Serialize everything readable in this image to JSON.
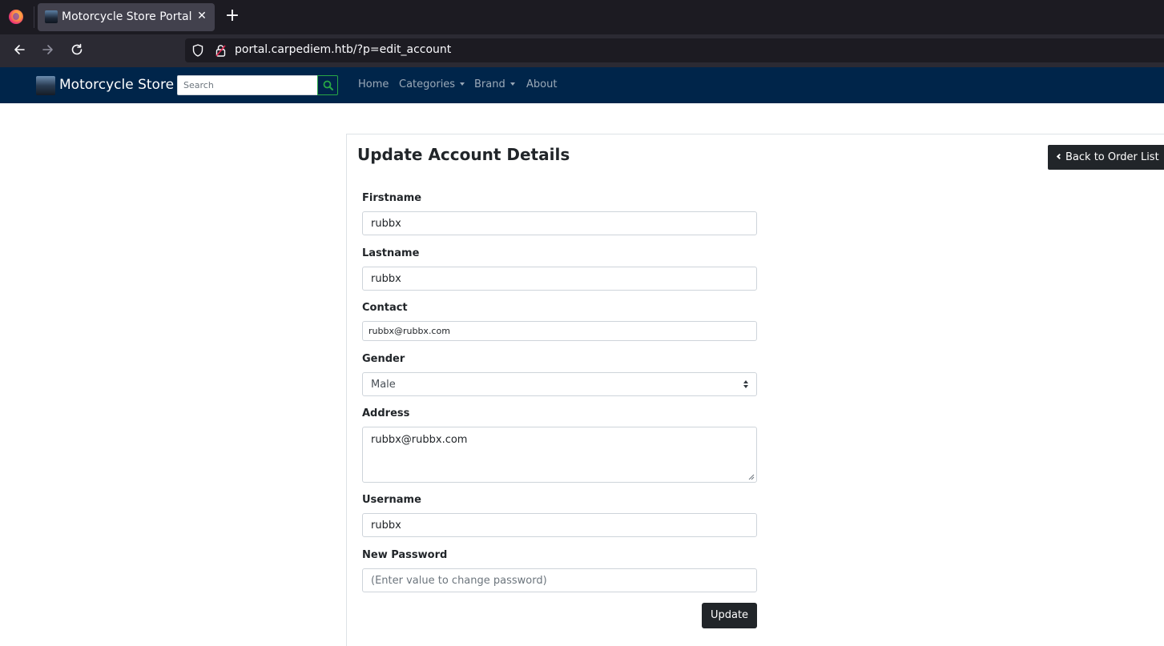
{
  "browser": {
    "tab_title": "Motorcycle Store Portal",
    "tab_close": "✕",
    "new_tab": "+",
    "url": "portal.carpediem.htb/?p=edit_account"
  },
  "site_nav": {
    "brand": "Motorcycle Store",
    "search_placeholder": "Search",
    "links": {
      "home": "Home",
      "categories": "Categories",
      "brand": "Brand",
      "about": "About"
    }
  },
  "page": {
    "title": "Update Account Details",
    "back_button": "Back to Order List",
    "update_button": "Update"
  },
  "form": {
    "firstname": {
      "label": "Firstname",
      "value": "rubbx"
    },
    "lastname": {
      "label": "Lastname",
      "value": "rubbx"
    },
    "contact": {
      "label": "Contact",
      "value": "rubbx@rubbx.com"
    },
    "gender": {
      "label": "Gender",
      "value": "Male"
    },
    "address": {
      "label": "Address",
      "value": "rubbx@rubbx.com"
    },
    "username": {
      "label": "Username",
      "value": "rubbx"
    },
    "password": {
      "label": "New Password",
      "placeholder": "(Enter value to change password)"
    }
  }
}
